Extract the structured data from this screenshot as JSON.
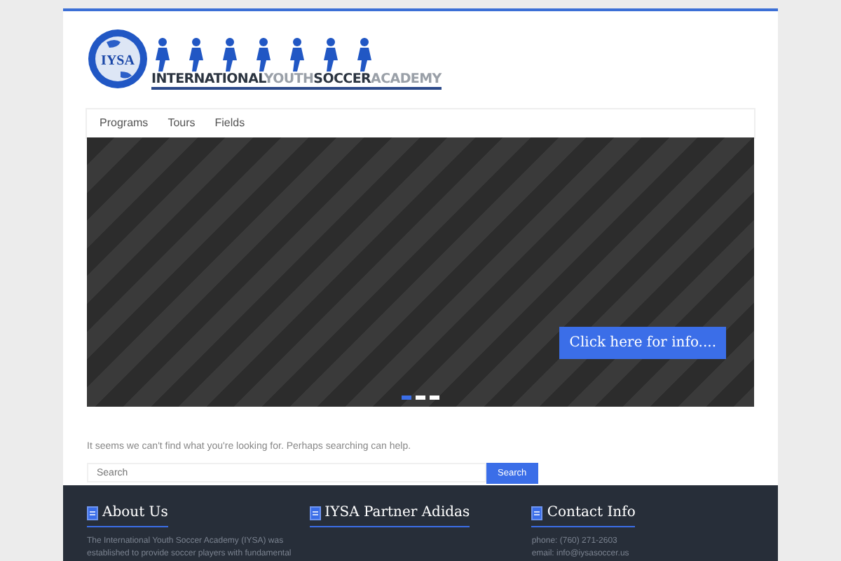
{
  "logo": {
    "badge": "IYSA",
    "words": [
      {
        "text": "INTERNATIONAL",
        "kind": "dark"
      },
      {
        "text": "YOUTH",
        "kind": "light"
      },
      {
        "text": "SOCCER",
        "kind": "dark"
      },
      {
        "text": "ACADEMY",
        "kind": "light"
      }
    ]
  },
  "nav": [
    {
      "label": "Programs"
    },
    {
      "label": "Tours"
    },
    {
      "label": "Fields"
    }
  ],
  "slider": {
    "button": "Click here for info....",
    "indicators": [
      {
        "selected": true
      },
      {
        "selected": false
      },
      {
        "selected": false
      }
    ]
  },
  "message": "It seems we can't find what you're looking for. Perhaps searching can help.",
  "search": {
    "placeholder": "Search",
    "button": "Search"
  },
  "footer": [
    {
      "title": "About Us",
      "lines": [
        "The International Youth Soccer Academy (IYSA) was",
        "established to provide soccer players with fundamental"
      ]
    },
    {
      "title": "IYSA Partner Adidas"
    },
    {
      "title": "Contact Info",
      "lines": [
        "phone: (760) 271-2603",
        "email: info@iysasoccer.us"
      ]
    }
  ]
}
